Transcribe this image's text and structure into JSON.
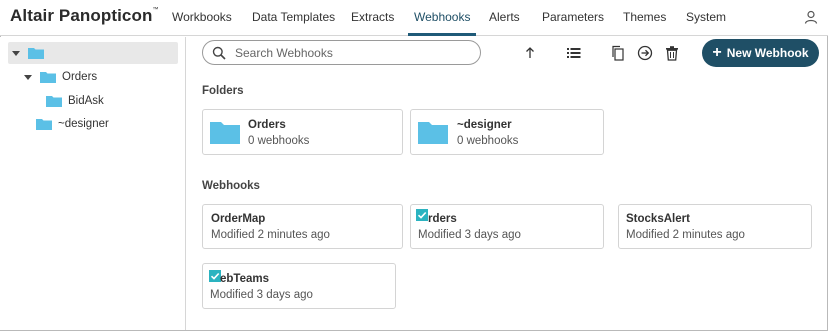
{
  "app": {
    "brand": "Altair Panopticon",
    "brand_mark": "™"
  },
  "nav": {
    "items": [
      {
        "label": "Workbooks"
      },
      {
        "label": "Data Templates"
      },
      {
        "label": "Extracts"
      },
      {
        "label": "Webhooks",
        "active": true
      },
      {
        "label": "Alerts"
      },
      {
        "label": "Parameters"
      },
      {
        "label": "Themes"
      },
      {
        "label": "System"
      }
    ]
  },
  "tree": {
    "root_label": "",
    "items": [
      {
        "label": "Orders",
        "expanded": true
      },
      {
        "label": "BidAsk"
      },
      {
        "label": "~designer"
      }
    ]
  },
  "search": {
    "placeholder": "Search Webhooks",
    "value": ""
  },
  "toolbar": {
    "new_label": "New Webhook"
  },
  "folders": {
    "title": "Folders",
    "items": [
      {
        "name": "Orders",
        "count": "0 webhooks"
      },
      {
        "name": "~designer",
        "count": "0 webhooks"
      }
    ]
  },
  "webhooks": {
    "title": "Webhooks",
    "items": [
      {
        "name": "OrderMap",
        "modified": "Modified 2 minutes ago"
      },
      {
        "name": "rders",
        "modified": "Modified 3 days ago"
      },
      {
        "name": "StocksAlert",
        "modified": "Modified 2 minutes ago"
      },
      {
        "name": "ebTeams",
        "modified": "Modified 3 days ago"
      }
    ]
  },
  "colors": {
    "accent": "#1f4f66",
    "folder": "#5bc0e6",
    "check": "#2bb3c0"
  }
}
